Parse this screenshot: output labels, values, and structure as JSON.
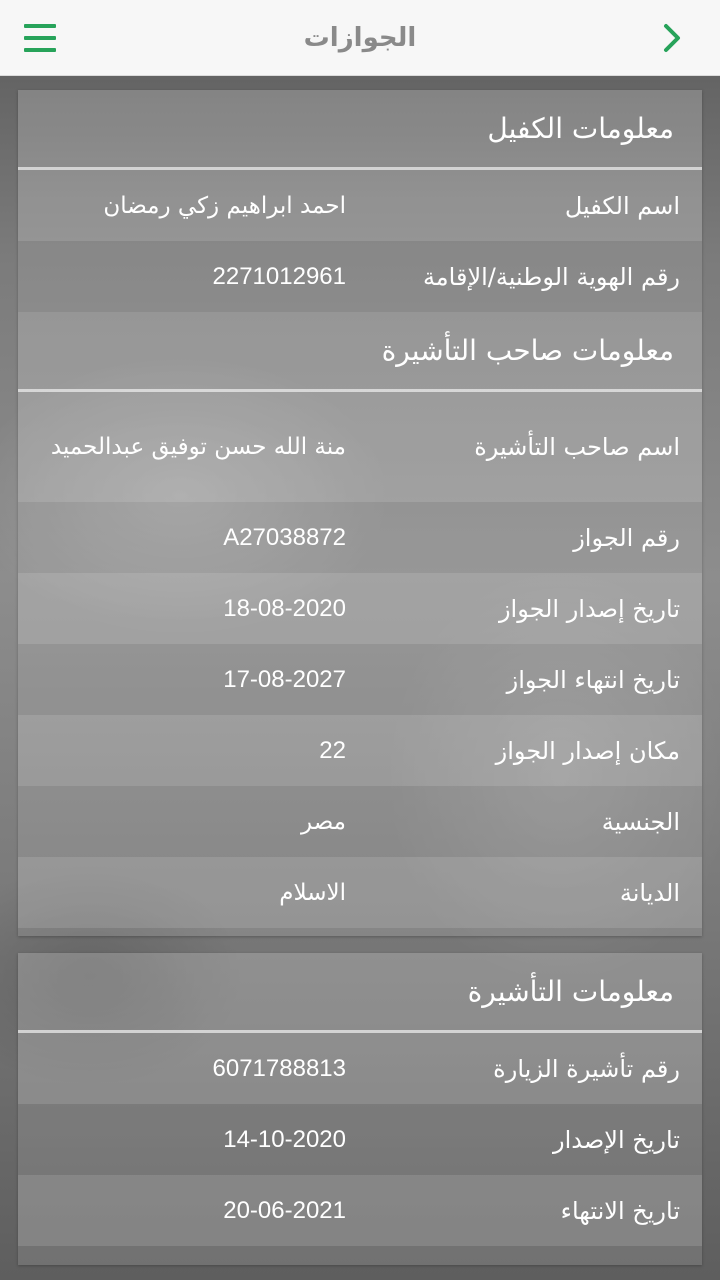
{
  "header": {
    "title": "الجوازات"
  },
  "sponsor_section": {
    "title": "معلومات الكفيل",
    "rows": [
      {
        "label": "اسم الكفيل",
        "value": "احمد ابراهيم زكي رمضان"
      },
      {
        "label": "رقم الهوية الوطنية/الإقامة",
        "value": "2271012961"
      }
    ]
  },
  "visa_holder_section": {
    "title": "معلومات صاحب التأشيرة",
    "rows": [
      {
        "label": "اسم صاحب التأشيرة",
        "value": "منة الله حسن توفيق عبدالحميد"
      },
      {
        "label": "رقم الجواز",
        "value": "A27038872"
      },
      {
        "label": "تاريخ إصدار الجواز",
        "value": "18-08-2020"
      },
      {
        "label": "تاريخ انتهاء الجواز",
        "value": "17-08-2027"
      },
      {
        "label": "مكان إصدار الجواز",
        "value": "22"
      },
      {
        "label": "الجنسية",
        "value": "مصر"
      },
      {
        "label": "الديانة",
        "value": "الاسلام"
      }
    ]
  },
  "visa_section": {
    "title": "معلومات التأشيرة",
    "rows": [
      {
        "label": "رقم تأشيرة الزيارة",
        "value": "6071788813"
      },
      {
        "label": "تاريخ الإصدار",
        "value": "14-10-2020"
      },
      {
        "label": "تاريخ الانتهاء",
        "value": "20-06-2021"
      }
    ]
  },
  "colors": {
    "accent": "#27a35a",
    "header_bg": "#f7f7f7",
    "header_text": "#8a8a8a"
  },
  "icons": {
    "menu": "hamburger-menu-icon",
    "back": "chevron-right-icon"
  }
}
